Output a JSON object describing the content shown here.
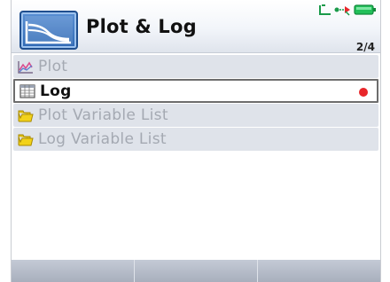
{
  "window": {
    "title": "Plot & Log",
    "page_indicator": "2/4",
    "app_icon": "plot-log-app-icon"
  },
  "status_bar": {
    "icons": [
      "usb-icon",
      "connection-icon",
      "battery-icon"
    ],
    "battery_color": "#22c05a"
  },
  "menu": {
    "items": [
      {
        "label": "Plot",
        "icon": "chart-icon",
        "state": "disabled"
      },
      {
        "label": "Log",
        "icon": "table-icon",
        "state": "selected",
        "recording": true
      },
      {
        "label": "Plot Variable List",
        "icon": "folder-icon",
        "state": "disabled"
      },
      {
        "label": "Log Variable List",
        "icon": "folder-icon",
        "state": "disabled"
      }
    ]
  },
  "softkeys": [
    "",
    "",
    ""
  ],
  "colors": {
    "record_dot": "#e8262a",
    "selected_border": "#6d6d6d",
    "disabled_text": "#a4a9b2",
    "item_background": "#dfe3ea",
    "folder_yellow": "#f2d21a"
  }
}
